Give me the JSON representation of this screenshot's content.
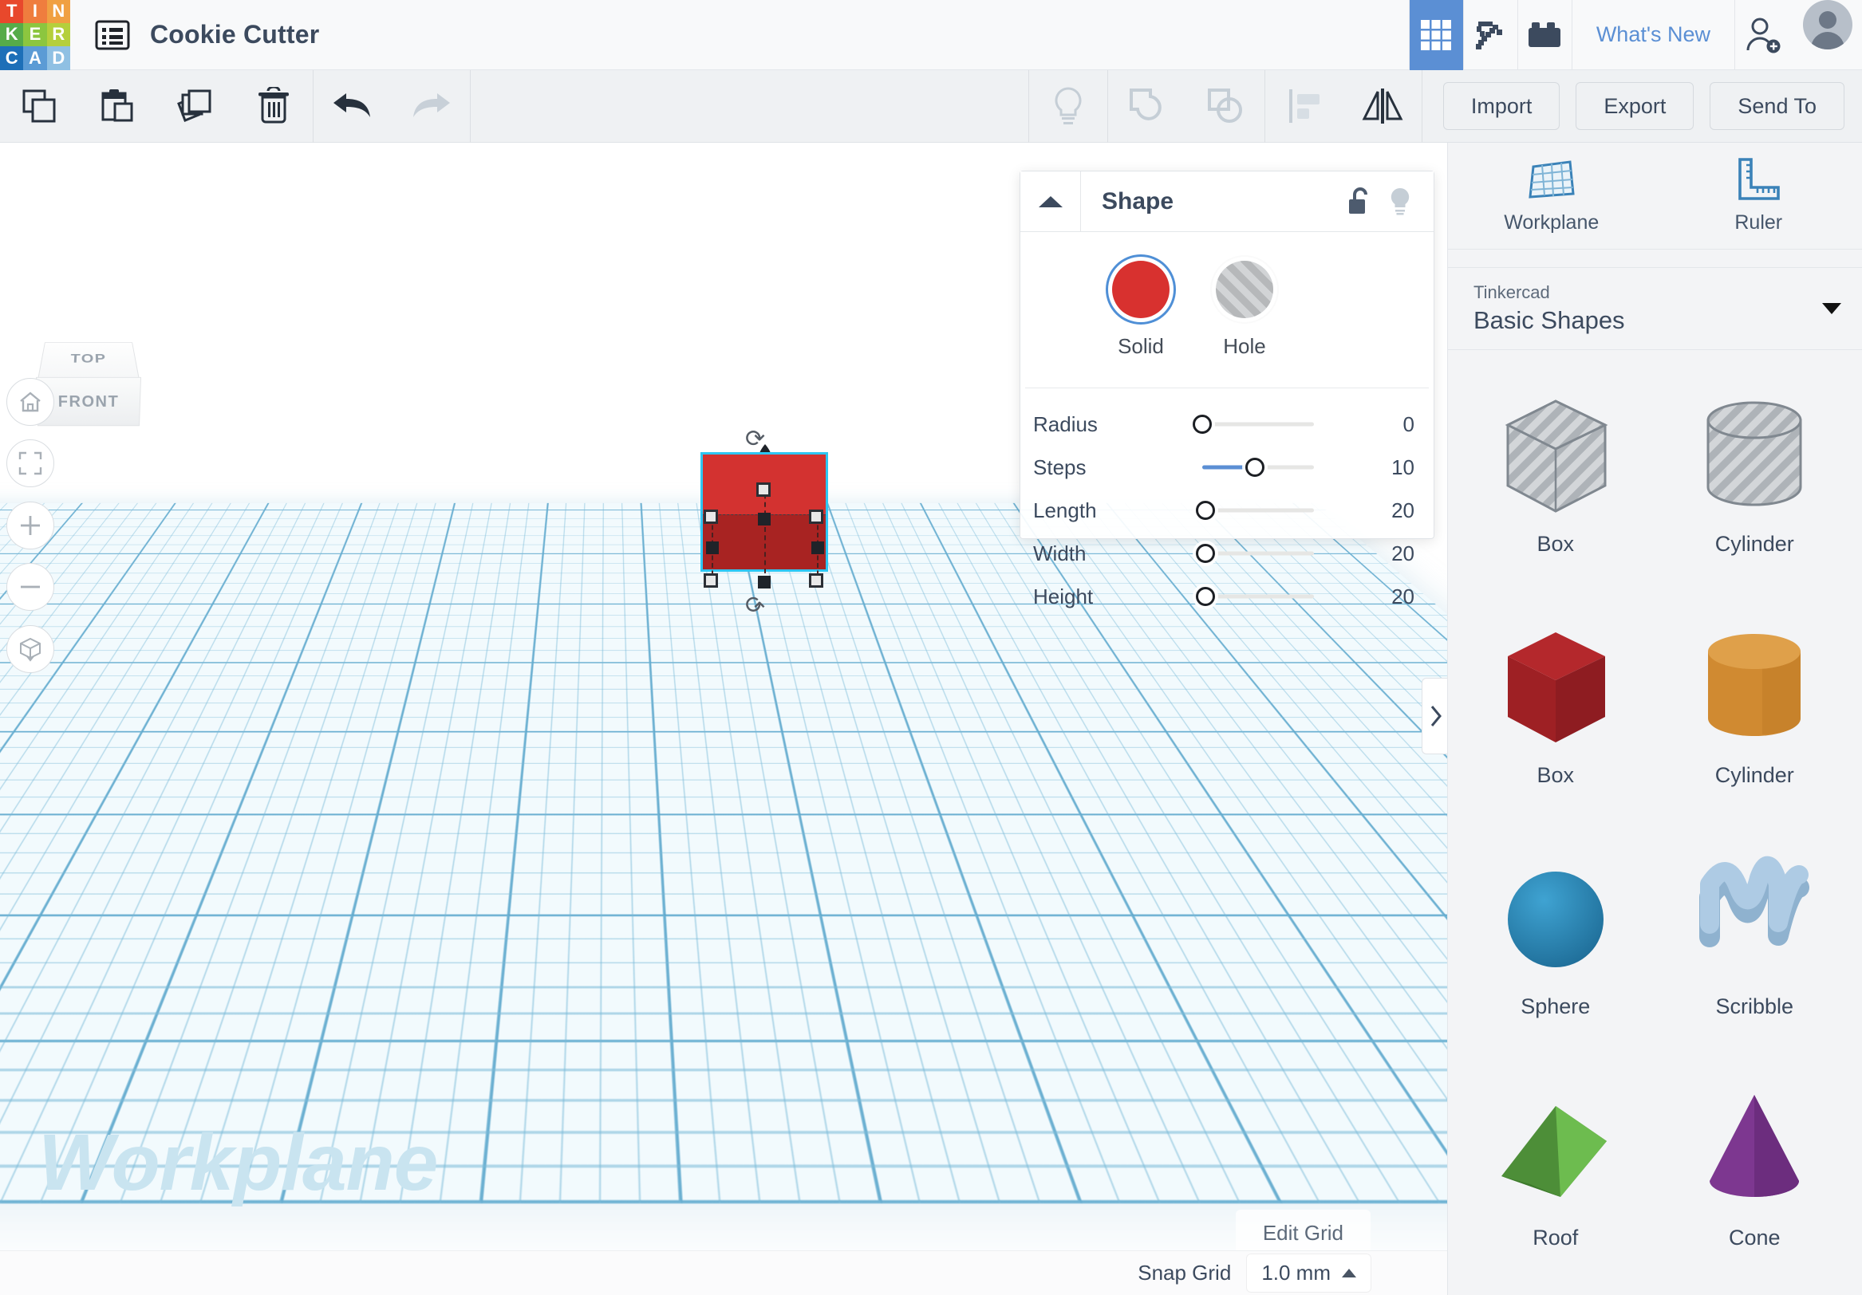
{
  "app": {
    "brand_letters": [
      "T",
      "I",
      "N",
      "K",
      "E",
      "R",
      "C",
      "A",
      "D"
    ],
    "project_title": "Cookie Cutter",
    "whats_new": "What's New",
    "top_icons": [
      {
        "name": "grid-apps-icon",
        "active": true
      },
      {
        "name": "pickaxe-minecraft-icon",
        "active": false
      },
      {
        "name": "lego-brick-icon",
        "active": false
      }
    ],
    "add_person_icon": "add-person-icon",
    "avatar": "user-avatar"
  },
  "toolbar": {
    "left_tools": [
      {
        "name": "copy-button",
        "icon": "copy-icon"
      },
      {
        "name": "paste-button",
        "icon": "paste-icon"
      },
      {
        "name": "duplicate-button",
        "icon": "duplicate-icon"
      },
      {
        "name": "delete-button",
        "icon": "trash-icon"
      }
    ],
    "history_tools": [
      {
        "name": "undo-button",
        "icon": "undo-arrow-icon",
        "enabled": true
      },
      {
        "name": "redo-button",
        "icon": "redo-arrow-icon",
        "enabled": false
      }
    ],
    "object_tools": [
      {
        "name": "hint-button",
        "icon": "lightbulb-icon",
        "enabled": false
      },
      {
        "name": "group-button",
        "icon": "group-shapes-icon",
        "enabled": false
      },
      {
        "name": "ungroup-button",
        "icon": "ungroup-shapes-icon",
        "enabled": false
      }
    ],
    "arrange_tools": [
      {
        "name": "align-button",
        "icon": "align-icon",
        "enabled": false
      },
      {
        "name": "mirror-button",
        "icon": "mirror-icon",
        "enabled": true
      }
    ],
    "actions": [
      {
        "label": "Import",
        "name": "import-button"
      },
      {
        "label": "Export",
        "name": "export-button"
      },
      {
        "label": "Send To",
        "name": "send-to-button"
      }
    ]
  },
  "viewport": {
    "view_cube": {
      "top_face": "TOP",
      "front_face": "FRONT"
    },
    "controls": [
      {
        "name": "home-view-button",
        "icon": "home-icon"
      },
      {
        "name": "fit-all-button",
        "icon": "fit-to-view-icon"
      },
      {
        "name": "zoom-in-button",
        "icon": "plus-icon"
      },
      {
        "name": "zoom-out-button",
        "icon": "minus-icon"
      },
      {
        "name": "ortho-perspective-button",
        "icon": "cube-view-icon"
      }
    ],
    "workplane_watermark": "Workplane",
    "edit_grid_label": "Edit Grid",
    "selected_shape_color": "#d33230",
    "selection_outline_color": "#2ec6f2"
  },
  "inspector": {
    "title": "Shape",
    "collapse_icon": "triangle-up-icon",
    "lock_icon": "unlocked-padlock-icon",
    "hint_icon": "lightbulb-icon",
    "swatches": [
      {
        "label": "Solid",
        "name": "solid-swatch",
        "color": "#d8312f",
        "selected": true
      },
      {
        "label": "Hole",
        "name": "hole-swatch",
        "color": "#c4c6c8",
        "selected": false
      }
    ],
    "sliders": [
      {
        "label": "Radius",
        "value": "0",
        "pct": 0
      },
      {
        "label": "Steps",
        "value": "10",
        "pct": 33
      },
      {
        "label": "Length",
        "value": "20",
        "pct": 0
      },
      {
        "label": "Width",
        "value": "20",
        "pct": 0
      },
      {
        "label": "Height",
        "value": "20",
        "pct": 0
      }
    ],
    "panel_toggle_icon": "chevron-right-icon"
  },
  "right_panel": {
    "tools": [
      {
        "label": "Workplane",
        "name": "workplane-tool",
        "icon": "workplane-grid-icon"
      },
      {
        "label": "Ruler",
        "name": "ruler-tool",
        "icon": "ruler-icon"
      }
    ],
    "library_select": {
      "sub_label": "Tinkercad",
      "main_label": "Basic Shapes",
      "caret_icon": "chevron-down-icon"
    },
    "shapes": [
      {
        "label": "Box",
        "name": "shape-box-hole",
        "kind": "box",
        "color": "#c0c4c8",
        "hole": true
      },
      {
        "label": "Cylinder",
        "name": "shape-cylinder-hole",
        "kind": "cylinder",
        "color": "#c0c4c8",
        "hole": true
      },
      {
        "label": "Box",
        "name": "shape-box-red",
        "kind": "box",
        "color": "#b32a28",
        "hole": false
      },
      {
        "label": "Cylinder",
        "name": "shape-cylinder-orange",
        "kind": "cylinder",
        "color": "#d9882f",
        "hole": false
      },
      {
        "label": "Sphere",
        "name": "shape-sphere",
        "kind": "sphere",
        "color": "#2b86b8",
        "hole": false
      },
      {
        "label": "Scribble",
        "name": "shape-scribble",
        "kind": "scribble",
        "color": "#9cbcd8",
        "hole": false
      },
      {
        "label": "Roof",
        "name": "shape-roof",
        "kind": "roof",
        "color": "#5aa83f",
        "hole": false
      },
      {
        "label": "Cone",
        "name": "shape-cone",
        "kind": "cone",
        "color": "#7c3a8f",
        "hole": false
      }
    ]
  },
  "status_bar": {
    "snap_grid_label": "Snap Grid",
    "snap_grid_value": "1.0 mm",
    "caret_icon": "caret-up-icon"
  }
}
